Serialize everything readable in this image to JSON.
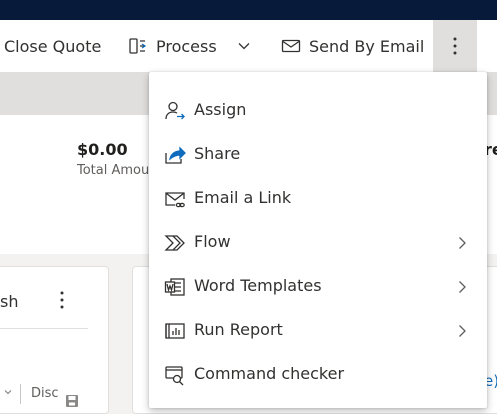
{
  "toolbar": {
    "close_quote_label": "Close Quote",
    "process_label": "Process",
    "send_by_email_label": "Send By Email"
  },
  "summary": {
    "amount": "$0.00",
    "amount_label": "Total Amou",
    "right_fragment": "re"
  },
  "card": {
    "text_fragment": "sh",
    "column_label": "Disc"
  },
  "right_link_fragment": "e)",
  "menu": {
    "items": [
      {
        "label": "Assign",
        "icon": "assign-person-icon",
        "submenu": false
      },
      {
        "label": "Share",
        "icon": "share-icon",
        "submenu": false
      },
      {
        "label": "Email a Link",
        "icon": "email-link-icon",
        "submenu": false
      },
      {
        "label": "Flow",
        "icon": "flow-icon",
        "submenu": true
      },
      {
        "label": "Word Templates",
        "icon": "word-templates-icon",
        "submenu": true
      },
      {
        "label": "Run Report",
        "icon": "run-report-icon",
        "submenu": true
      },
      {
        "label": "Command checker",
        "icon": "command-checker-icon",
        "submenu": false
      }
    ]
  },
  "colors": {
    "topbar": "#071a3a",
    "accent": "#0f6cbd",
    "selected_button_bg": "#e1dfdd"
  }
}
